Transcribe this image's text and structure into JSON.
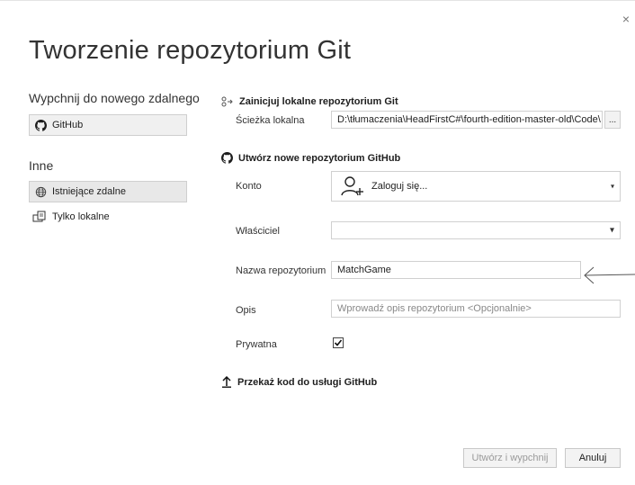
{
  "dialog": {
    "title": "Tworzenie repozytorium Git",
    "close_glyph": "×"
  },
  "left": {
    "push_heading": "Wypchnij do nowego zdalnego",
    "github_button": "GitHub",
    "other_heading": "Inne",
    "items": [
      {
        "label": "Istniejące zdalne",
        "icon": "globe-icon",
        "selected": true
      },
      {
        "label": "Tylko lokalne",
        "icon": "local-repo-icon",
        "selected": false
      }
    ]
  },
  "local": {
    "heading": "Zainicjuj lokalne repozytorium Git",
    "path_label": "Ścieżka lokalna",
    "path_value": "D:\\tłumaczenia\\HeadFirstC#\\fourth-edition-master-old\\Code\\",
    "browse_label": "..."
  },
  "github": {
    "heading": "Utwórz nowe repozytorium GitHub",
    "account_label": "Konto",
    "account_value": "Zaloguj się...",
    "owner_label": "Właściciel",
    "owner_value": "",
    "repo_label": "Nazwa repozytorium",
    "repo_value": "MatchGame",
    "description_label": "Opis",
    "description_placeholder": "Wprowadź opis repozytorium <Opcjonalnie>",
    "private_label": "Prywatna",
    "private_checked": true
  },
  "push": {
    "heading": "Przekaż kod do usługi GitHub"
  },
  "footer": {
    "create_button": "Utwórz i wypchnij",
    "cancel_button": "Anuluj"
  },
  "colors": {
    "accent_text": "#1e1e1e",
    "border": "#d0d0d0",
    "disabled_text": "#9a9a9a"
  }
}
